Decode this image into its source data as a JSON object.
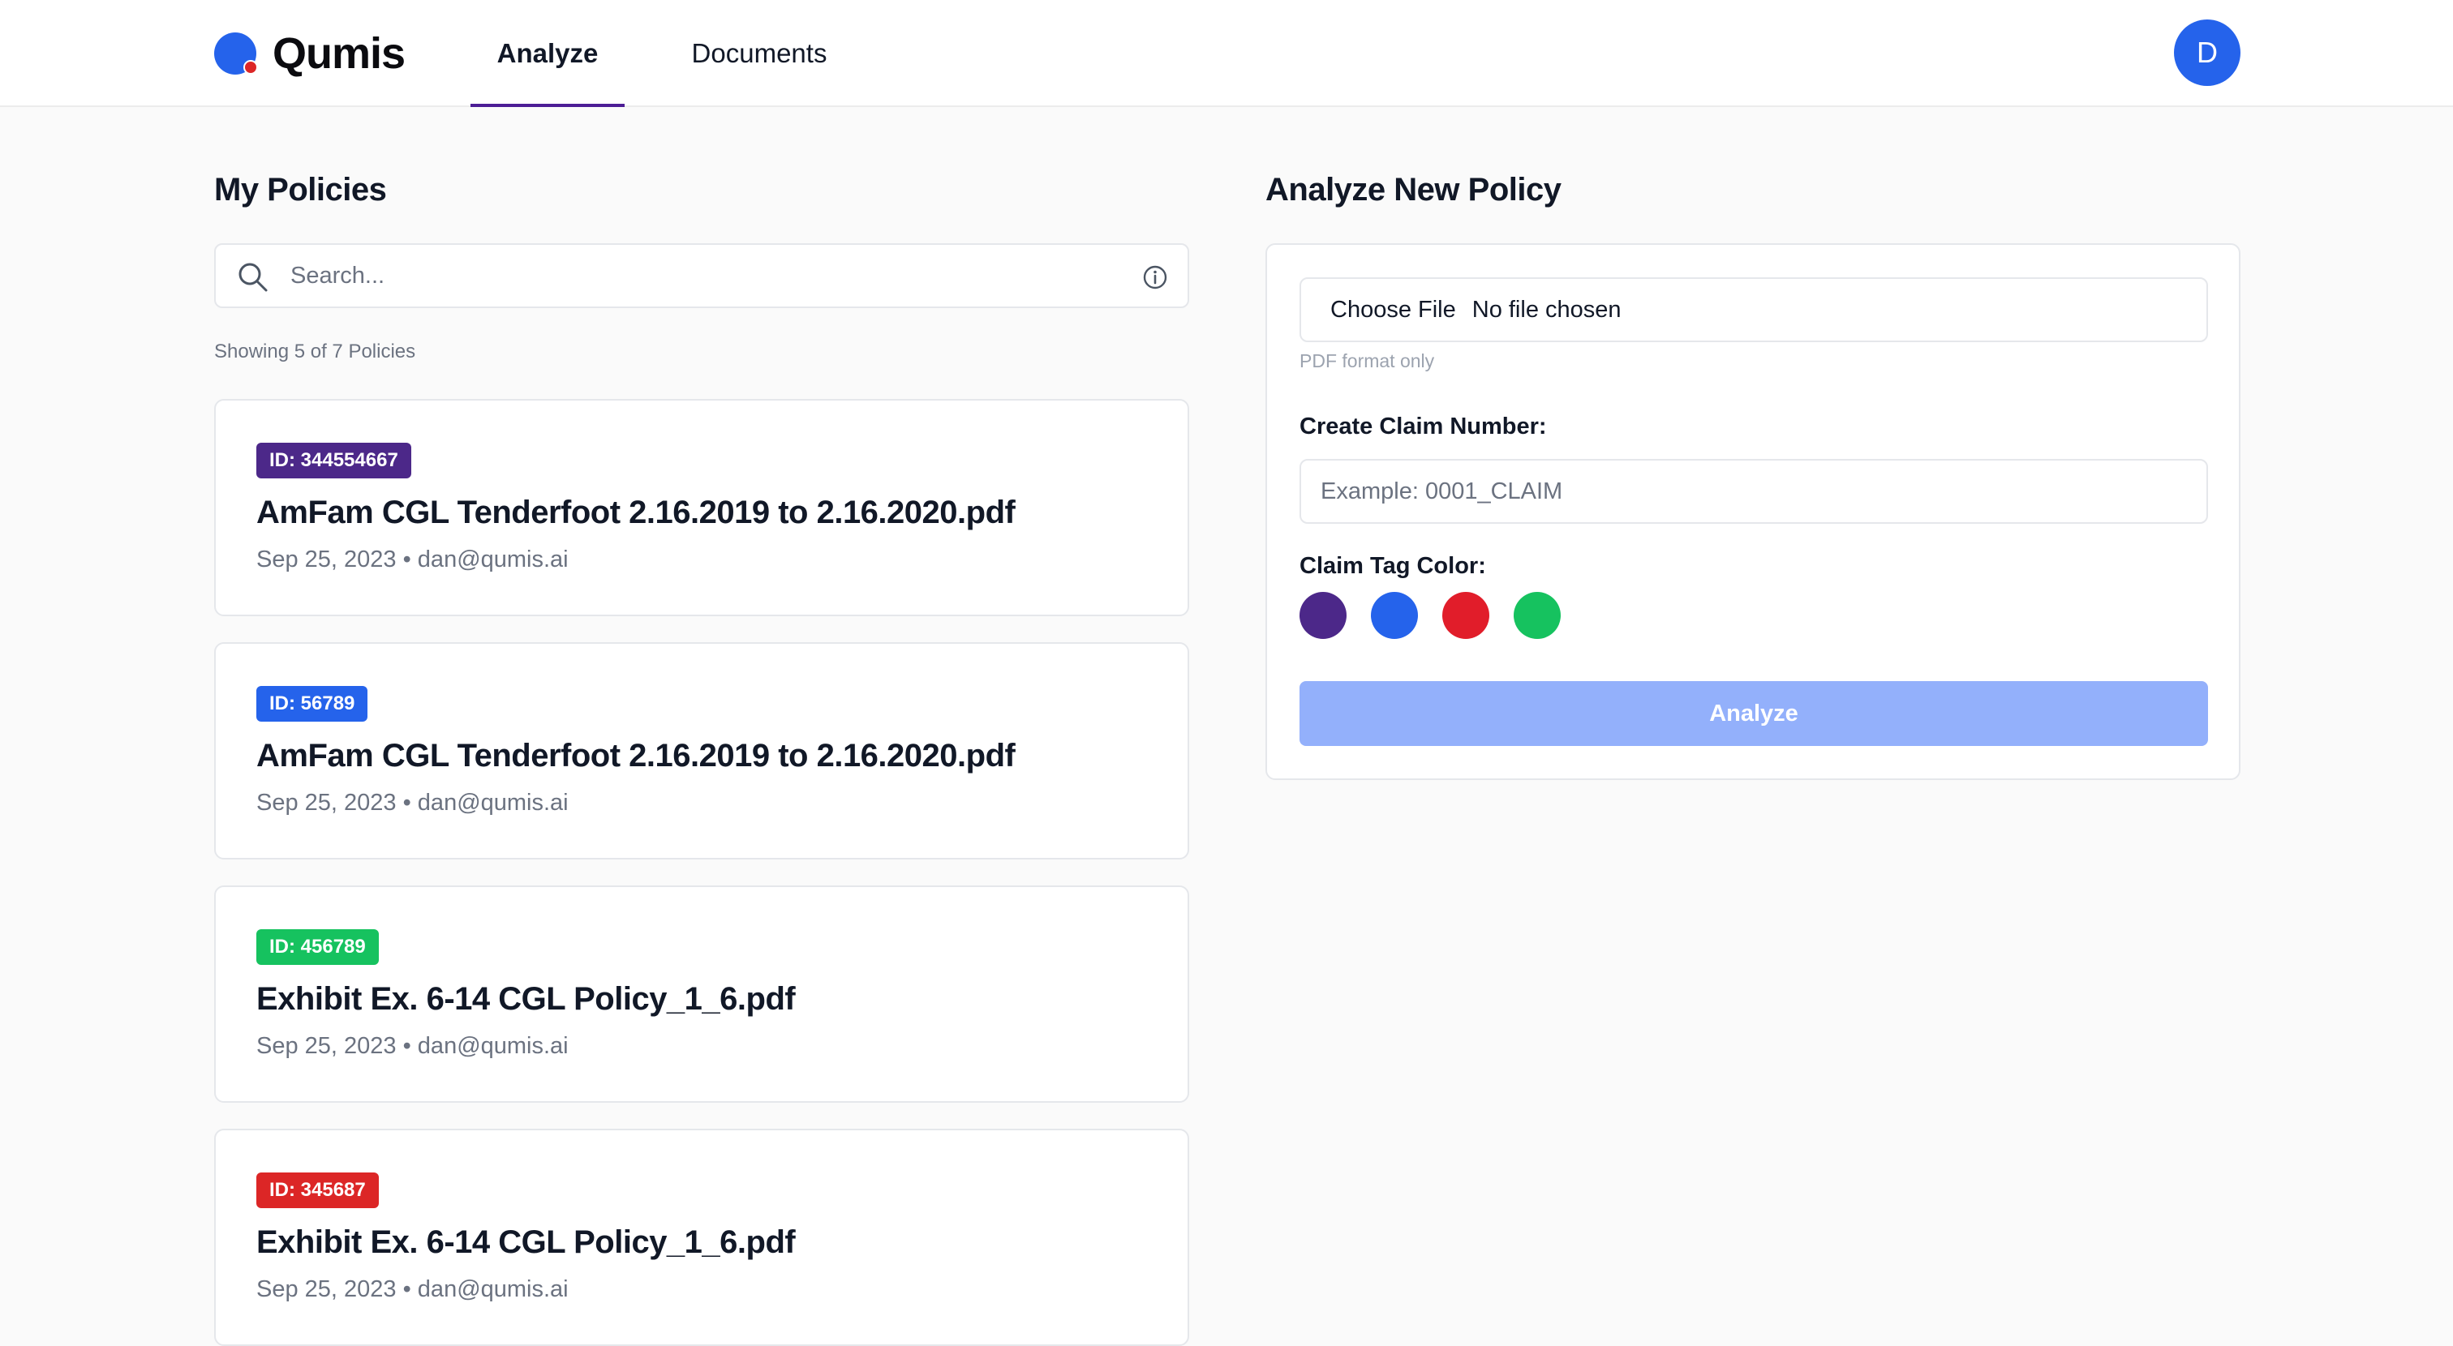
{
  "header": {
    "brand": "Qumis",
    "tabs": [
      {
        "label": "Analyze",
        "active": true
      },
      {
        "label": "Documents",
        "active": false
      }
    ],
    "avatar_initial": "D"
  },
  "policies": {
    "title": "My Policies",
    "search_placeholder": "Search...",
    "showing_text": "Showing 5 of 7 Policies",
    "items": [
      {
        "badge": "ID: 344554667",
        "badge_color": "#4c2889",
        "name": "AmFam CGL Tenderfoot 2.16.2019 to 2.16.2020.pdf",
        "meta": "Sep 25, 2023 • dan@qumis.ai"
      },
      {
        "badge": "ID: 56789",
        "badge_color": "#2563eb",
        "name": "AmFam CGL Tenderfoot 2.16.2019 to 2.16.2020.pdf",
        "meta": "Sep 25, 2023 • dan@qumis.ai"
      },
      {
        "badge": "ID: 456789",
        "badge_color": "#16c25f",
        "name": "Exhibit Ex. 6-14 CGL Policy_1_6.pdf",
        "meta": "Sep 25, 2023 • dan@qumis.ai"
      },
      {
        "badge": "ID: 345687",
        "badge_color": "#dc2626",
        "name": "Exhibit Ex. 6-14 CGL Policy_1_6.pdf",
        "meta": "Sep 25, 2023 • dan@qumis.ai"
      }
    ]
  },
  "analyze": {
    "title": "Analyze New Policy",
    "choose_file_label": "Choose File",
    "no_file_text": "No file chosen",
    "format_hint": "PDF format only",
    "claim_label": "Create Claim Number:",
    "claim_placeholder": "Example: 0001_CLAIM",
    "color_label": "Claim Tag Color:",
    "colors": [
      "#4c2889",
      "#2563eb",
      "#e11d2a",
      "#16c25f"
    ],
    "button_label": "Analyze"
  }
}
